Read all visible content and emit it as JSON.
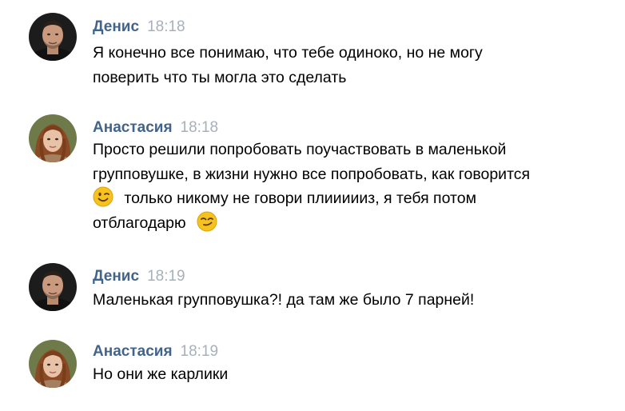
{
  "messages": [
    {
      "author": "Денис",
      "time": "18:18",
      "avatar": "man-avatar",
      "lines": [
        "Я конечно все понимаю, что тебе одиноко, но не могу",
        "поверить что ты могла это сделать"
      ]
    },
    {
      "author": "Анастасия",
      "time": "18:18",
      "avatar": "woman-avatar",
      "lines": [
        "Просто решили попробовать поучаствовать в маленькой",
        "групповушке, в жизни нужно все попробовать, как говорится",
        "только никому не говори плиииииз, я тебя потом",
        "отблагодарю"
      ],
      "emojis": [
        "wink-emoji",
        "smirk-emoji"
      ]
    },
    {
      "author": "Денис",
      "time": "18:19",
      "avatar": "man-avatar",
      "lines": [
        "Маленькая групповушка?! да там же было 7 парней!"
      ]
    },
    {
      "author": "Анастасия",
      "time": "18:19",
      "avatar": "woman-avatar",
      "lines": [
        "Но они же карлики"
      ]
    }
  ],
  "colors": {
    "author": "#42648b",
    "time": "#a8b0ba",
    "text": "#000000",
    "background": "#ffffff",
    "emoji": "#f7c21e"
  }
}
